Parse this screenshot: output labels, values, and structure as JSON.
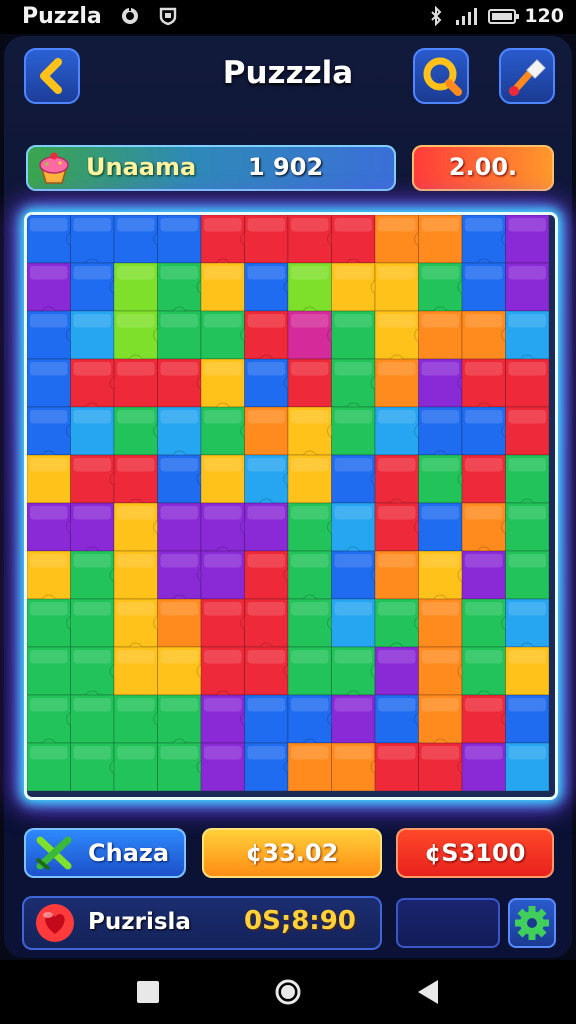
{
  "status_bar": {
    "app_title": "Puzzla",
    "time": "120",
    "icons": [
      "app-icon",
      "shield-icon",
      "bluetooth-icon",
      "signal-icon",
      "battery-icon"
    ]
  },
  "header": {
    "title": "Puzzzla",
    "back_icon": "chevron-left-icon",
    "search_icon": "search-icon",
    "paint_icon": "paintbrush-icon"
  },
  "info_bar": {
    "name": "Unaama",
    "number": "1 902",
    "icon": "cupcake-icon"
  },
  "price_badge": {
    "value": "2.00."
  },
  "board": {
    "rows": 12,
    "cols": 12,
    "colors": {
      "B": "#1f6cf0",
      "G": "#22c35a",
      "g": "#7ee02a",
      "R": "#ee2a3a",
      "P": "#8a2ad6",
      "Y": "#ffc21a",
      "O": "#ff8a1e",
      "C": "#26a6f0",
      "M": "#d42a9a"
    },
    "grid": [
      "BBBBRRRROOBP",
      "PBgGYBgYYGBP",
      "BCgGGRMGYOOC",
      "BRRRYBRGOPRR",
      "BCGCGOYGCBBR",
      "YRRBYCYBRGRG",
      "PPYPPPGCRBOG",
      "YGYPPRGBOYPG",
      "GGYORRGCGOGC",
      "GGYYRRGGPOGY",
      "GGGGPBBPBORB",
      "GGGGPBOORRPC"
    ]
  },
  "buttons": {
    "chaza": {
      "label": "Chaza",
      "icon": "crossed-swords-icon"
    },
    "middle": {
      "label": "¢33.02"
    },
    "right": {
      "label": "¢S3100"
    }
  },
  "bottom_bar": {
    "icon": "heart-icon",
    "label": "Puzrisla",
    "score": "0S;8:90",
    "settings_icon": "gear-icon"
  },
  "nav": {
    "icons": [
      "square-icon",
      "circle-icon",
      "back-triangle-icon"
    ]
  }
}
